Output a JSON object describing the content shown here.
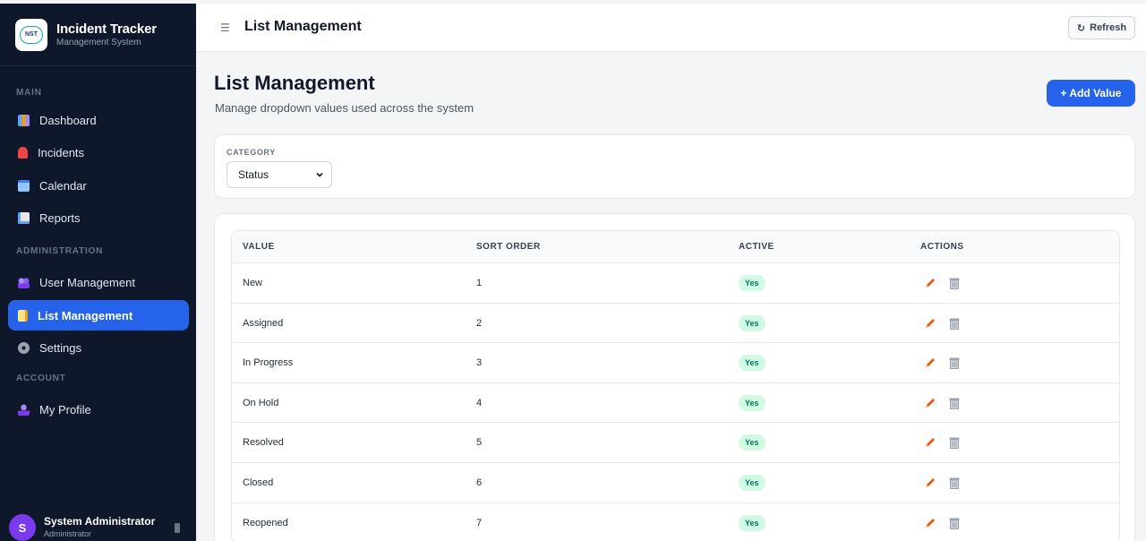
{
  "brand": {
    "title": "Incident Tracker",
    "subtitle": "Management System",
    "logo_text": "NST"
  },
  "sidebar": {
    "sections": [
      {
        "label": "MAIN"
      },
      {
        "label": "ADMINISTRATION"
      },
      {
        "label": "ACCOUNT"
      }
    ],
    "items": [
      {
        "label": "Dashboard",
        "icon": "dashboard-icon"
      },
      {
        "label": "Incidents",
        "icon": "siren-icon"
      },
      {
        "label": "Calendar",
        "icon": "calendar-icon"
      },
      {
        "label": "Reports",
        "icon": "chart-icon"
      },
      {
        "label": "User Management",
        "icon": "users-icon"
      },
      {
        "label": "List Management",
        "icon": "document-icon",
        "active": true
      },
      {
        "label": "Settings",
        "icon": "gear-icon"
      },
      {
        "label": "My Profile",
        "icon": "user-icon"
      }
    ],
    "user": {
      "initial": "S",
      "name": "System Administrator",
      "role": "Administrator"
    }
  },
  "topbar": {
    "menu_icon": "☰",
    "title": "List Management",
    "refresh_label": "Refresh",
    "refresh_icon": "↻"
  },
  "page": {
    "title": "List Management",
    "subtitle": "Manage dropdown values used across the system",
    "add_button": "+ Add Value"
  },
  "filter": {
    "label": "CATEGORY",
    "selected": "Status"
  },
  "table": {
    "columns": [
      "VALUE",
      "SORT ORDER",
      "ACTIVE",
      "ACTIONS"
    ],
    "rows": [
      {
        "value": "New",
        "sort": "1",
        "active": "Yes"
      },
      {
        "value": "Assigned",
        "sort": "2",
        "active": "Yes"
      },
      {
        "value": "In Progress",
        "sort": "3",
        "active": "Yes"
      },
      {
        "value": "On Hold",
        "sort": "4",
        "active": "Yes"
      },
      {
        "value": "Resolved",
        "sort": "5",
        "active": "Yes"
      },
      {
        "value": "Closed",
        "sort": "6",
        "active": "Yes"
      },
      {
        "value": "Reopened",
        "sort": "7",
        "active": "Yes"
      }
    ]
  },
  "colors": {
    "sidebar_bg": "#0f172a",
    "accent": "#2563eb",
    "badge_bg": "#d1fae5",
    "badge_text": "#047857",
    "edit_icon": "#ea580c"
  }
}
